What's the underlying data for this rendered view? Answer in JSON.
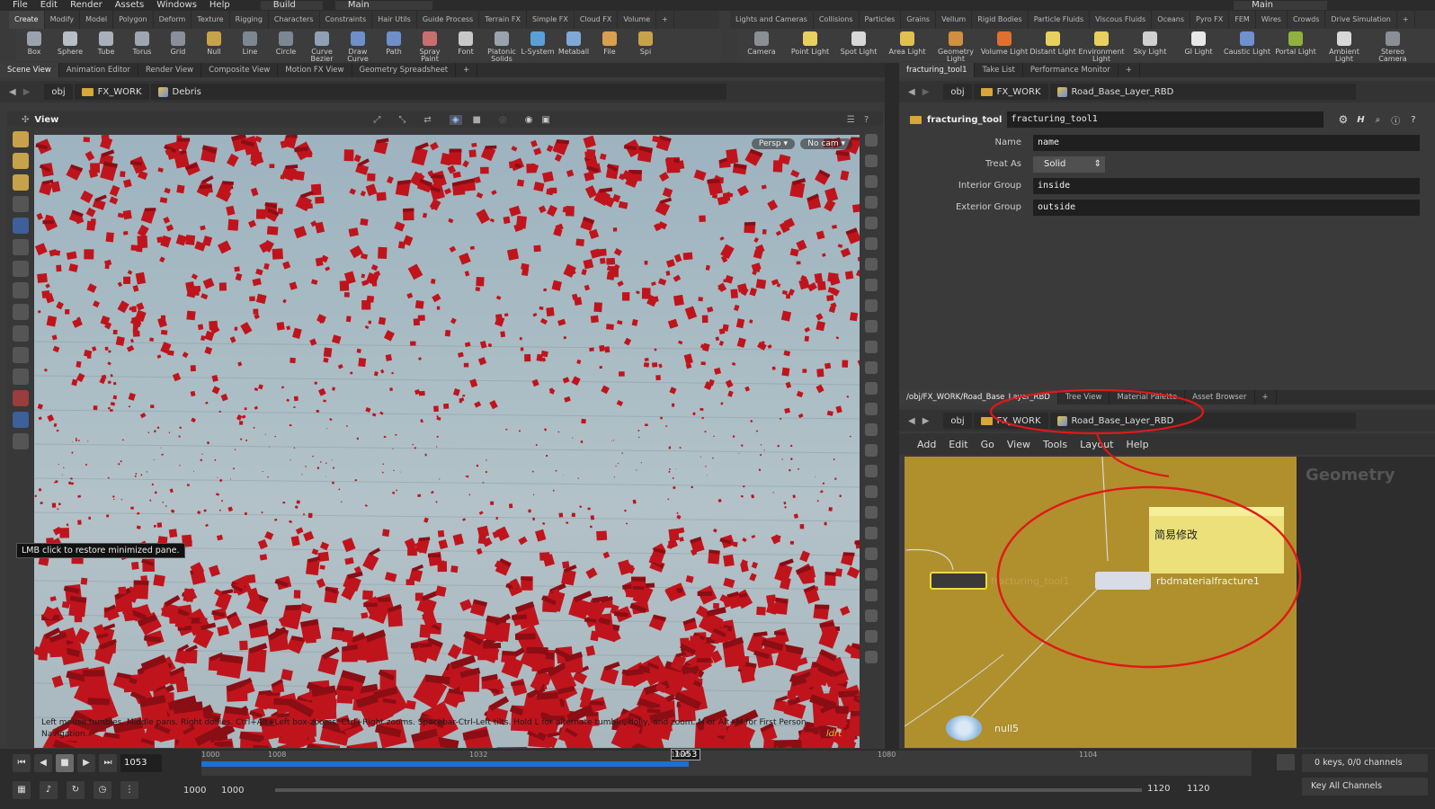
{
  "menu": [
    "File",
    "Edit",
    "Render",
    "Assets",
    "Windows",
    "Help"
  ],
  "desktop": {
    "build": "Build",
    "main": "Main",
    "main_right": "Main"
  },
  "shelf_left_tabs": [
    "Create",
    "Modify",
    "Model",
    "Polygon",
    "Deform",
    "Texture",
    "Rigging",
    "Characters",
    "Constraints",
    "Hair Utils",
    "Guide Process",
    "Terrain FX",
    "Simple FX",
    "Cloud FX",
    "Volume"
  ],
  "shelf_right_tabs": [
    "Lights and Cameras",
    "Collisions",
    "Particles",
    "Grains",
    "Vellum",
    "Rigid Bodies",
    "Particle Fluids",
    "Viscous Fluids",
    "Oceans",
    "Pyro FX",
    "FEM",
    "Wires",
    "Crowds",
    "Drive Simulation"
  ],
  "tools_left": [
    {
      "label": "Box",
      "color": "#9aa3ad"
    },
    {
      "label": "Sphere",
      "color": "#b8bec6"
    },
    {
      "label": "Tube",
      "color": "#a9b0b9"
    },
    {
      "label": "Torus",
      "color": "#9fa6b0"
    },
    {
      "label": "Grid",
      "color": "#8a9099"
    },
    {
      "label": "Null",
      "color": "#c8a24a"
    },
    {
      "label": "Line",
      "color": "#7d8792"
    },
    {
      "label": "Circle",
      "color": "#7d8792"
    },
    {
      "label": "Curve Bezier",
      "color": "#8fa0b5"
    },
    {
      "label": "Draw Curve",
      "color": "#6e8fc9"
    },
    {
      "label": "Path",
      "color": "#6e8fc9"
    },
    {
      "label": "Spray Paint",
      "color": "#c96e6e"
    },
    {
      "label": "Font",
      "color": "#c9c9c9"
    },
    {
      "label": "Platonic Solids",
      "color": "#9aa3ad"
    },
    {
      "label": "L-System",
      "color": "#5aa0d8"
    },
    {
      "label": "Metaball",
      "color": "#7fa8d8"
    },
    {
      "label": "File",
      "color": "#d8a050"
    },
    {
      "label": "Spi",
      "color": "#c8a24a"
    }
  ],
  "tools_right": [
    {
      "label": "Camera",
      "color": "#8a8f96"
    },
    {
      "label": "Point Light",
      "color": "#e8d060"
    },
    {
      "label": "Spot Light",
      "color": "#d8d8d8"
    },
    {
      "label": "Area Light",
      "color": "#e0c050"
    },
    {
      "label": "Geometry Light",
      "color": "#d09040"
    },
    {
      "label": "Volume Light",
      "color": "#e07030"
    },
    {
      "label": "Distant Light",
      "color": "#e8d060"
    },
    {
      "label": "Environment Light",
      "color": "#e8d060"
    },
    {
      "label": "Sky Light",
      "color": "#d0d0d0"
    },
    {
      "label": "GI Light",
      "color": "#e8e8e8"
    },
    {
      "label": "Caustic Light",
      "color": "#7090d0"
    },
    {
      "label": "Portal Light",
      "color": "#90b040"
    },
    {
      "label": "Ambient Light",
      "color": "#d8d8d8"
    },
    {
      "label": "Stereo Camera",
      "color": "#8a8f96"
    }
  ],
  "left_pane_tabs": [
    "Scene View",
    "Animation Editor",
    "Render View",
    "Composite View",
    "Motion FX View",
    "Geometry Spreadsheet"
  ],
  "left_path": {
    "obj": "obj",
    "work": "FX_WORK",
    "node": "Debris"
  },
  "view": {
    "label": "View",
    "persp": "Persp",
    "cam": "No cam",
    "hint": "Left mouse tumbles. Middle pans. Right dollies. Ctrl+Alt+Left box-zooms. Ctrl+Right zooms. Spacebar-Ctrl-Left tilts. Hold L for alternate tumble, dolly, and zoom.    M or Alt+M for First Person Navigation.",
    "tooltip": "LMB click to restore minimized pane.",
    "watermark": "ldrt"
  },
  "right_pane_tabs": [
    "fracturing_tool1",
    "Take List",
    "Performance Monitor"
  ],
  "right_path": {
    "obj": "obj",
    "work": "FX_WORK",
    "node": "Road_Base_Layer_RBD"
  },
  "params": {
    "node_type": "fracturing_tool",
    "node_name": "fracturing_tool1",
    "rows": [
      {
        "label": "Name",
        "value": "name"
      },
      {
        "label": "Treat As",
        "value": "Solid"
      },
      {
        "label": "Interior Group",
        "value": "inside"
      },
      {
        "label": "Exterior Group",
        "value": "outside"
      }
    ]
  },
  "net_tabs": [
    "/obj/FX_WORK/Road_Base_Layer_RBD",
    "Tree View",
    "Material Palette",
    "Asset Browser"
  ],
  "net_path": {
    "obj": "obj",
    "work": "FX_WORK",
    "node": "Road_Base_Layer_RBD"
  },
  "net_menu": [
    "Add",
    "Edit",
    "Go",
    "View",
    "Tools",
    "Layout",
    "Help"
  ],
  "net": {
    "context": "Geometry",
    "sticky": "简易修改",
    "node1": "fracturing_tool1",
    "node2": "rbdmaterialfracture1",
    "node3": "null5"
  },
  "timeline": {
    "frame": "1053",
    "marker": "1053",
    "ticks": [
      "1000",
      "1008",
      "1032",
      "1056",
      "1080",
      "1104"
    ],
    "start": "1000",
    "start2": "1000",
    "end": "1120",
    "end2": "1120",
    "keys": "0 keys, 0/0 channels",
    "keyall": "Key All Channels",
    "progress": 0.464
  },
  "colors": {
    "accent": "#1e6fd0",
    "net_bg": "#b0902d",
    "annotation": "#e01818",
    "debris": "#c0141c"
  }
}
